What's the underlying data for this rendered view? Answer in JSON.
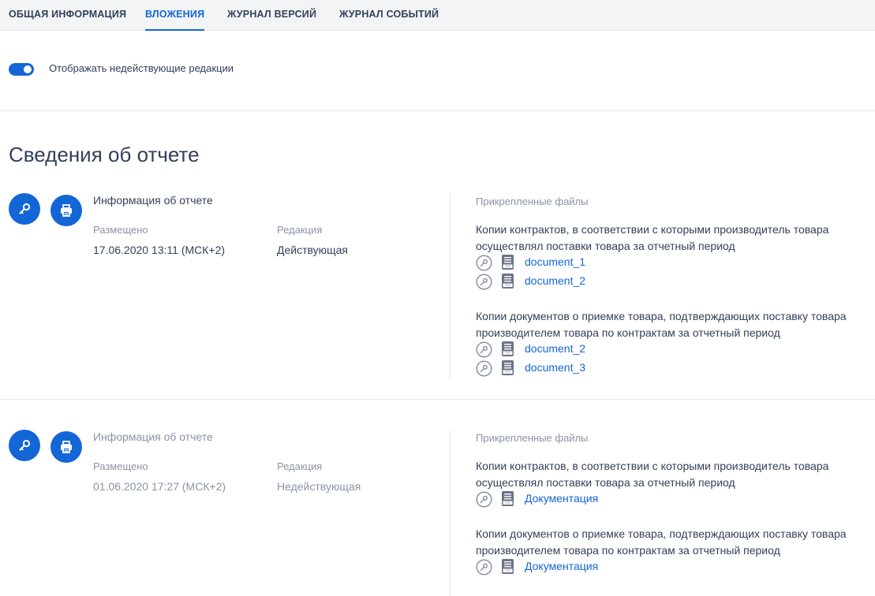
{
  "tabs": [
    {
      "label": "ОБЩАЯ ИНФОРМАЦИЯ",
      "active": false
    },
    {
      "label": "ВЛОЖЕНИЯ",
      "active": true
    },
    {
      "label": "ЖУРНАЛ ВЕРСИЙ",
      "active": false
    },
    {
      "label": "ЖУРНАЛ СОБЫТИЙ",
      "active": false
    }
  ],
  "toggle": {
    "label": "Отображать недействующие редакции",
    "checked": true
  },
  "page_title": "Сведения об отчете",
  "colors": {
    "accent": "#1366d6",
    "text": "#334059",
    "muted": "#8a93a6"
  },
  "reports": [
    {
      "info_title": "Информация об отчете",
      "placed_label": "Размещено",
      "placed_value": "17.06.2020 13:11 (МСК+2)",
      "edition_label": "Редакция",
      "edition_value": "Действующая",
      "files_title": "Прикрепленные файлы",
      "groups": [
        {
          "description": "Копии контрактов, в соответствии с которыми производитель товара осуществлял поставки товара за отчетный период",
          "files": [
            "document_1",
            "document_2"
          ]
        },
        {
          "description": "Копии документов о приемке товара, подтверждающих поставку товара производителем товара по контрактам за отчетный период",
          "files": [
            "document_2",
            "document_3"
          ]
        }
      ]
    },
    {
      "info_title": "Информация об отчете",
      "placed_label": "Размещено",
      "placed_value": "01.06.2020 17:27 (МСК+2)",
      "edition_label": "Редакция",
      "edition_value": "Недействующая",
      "files_title": "Прикрепленные файлы",
      "groups": [
        {
          "description": "Копии контрактов, в соответствии с которыми производитель товара осуществлял поставки товара за отчетный период",
          "files": [
            "Документация"
          ]
        },
        {
          "description": "Копии документов о приемке товара, подтверждающих поставку товара производителем товара по контрактам за отчетный период",
          "files": [
            "Документация"
          ]
        }
      ]
    }
  ]
}
